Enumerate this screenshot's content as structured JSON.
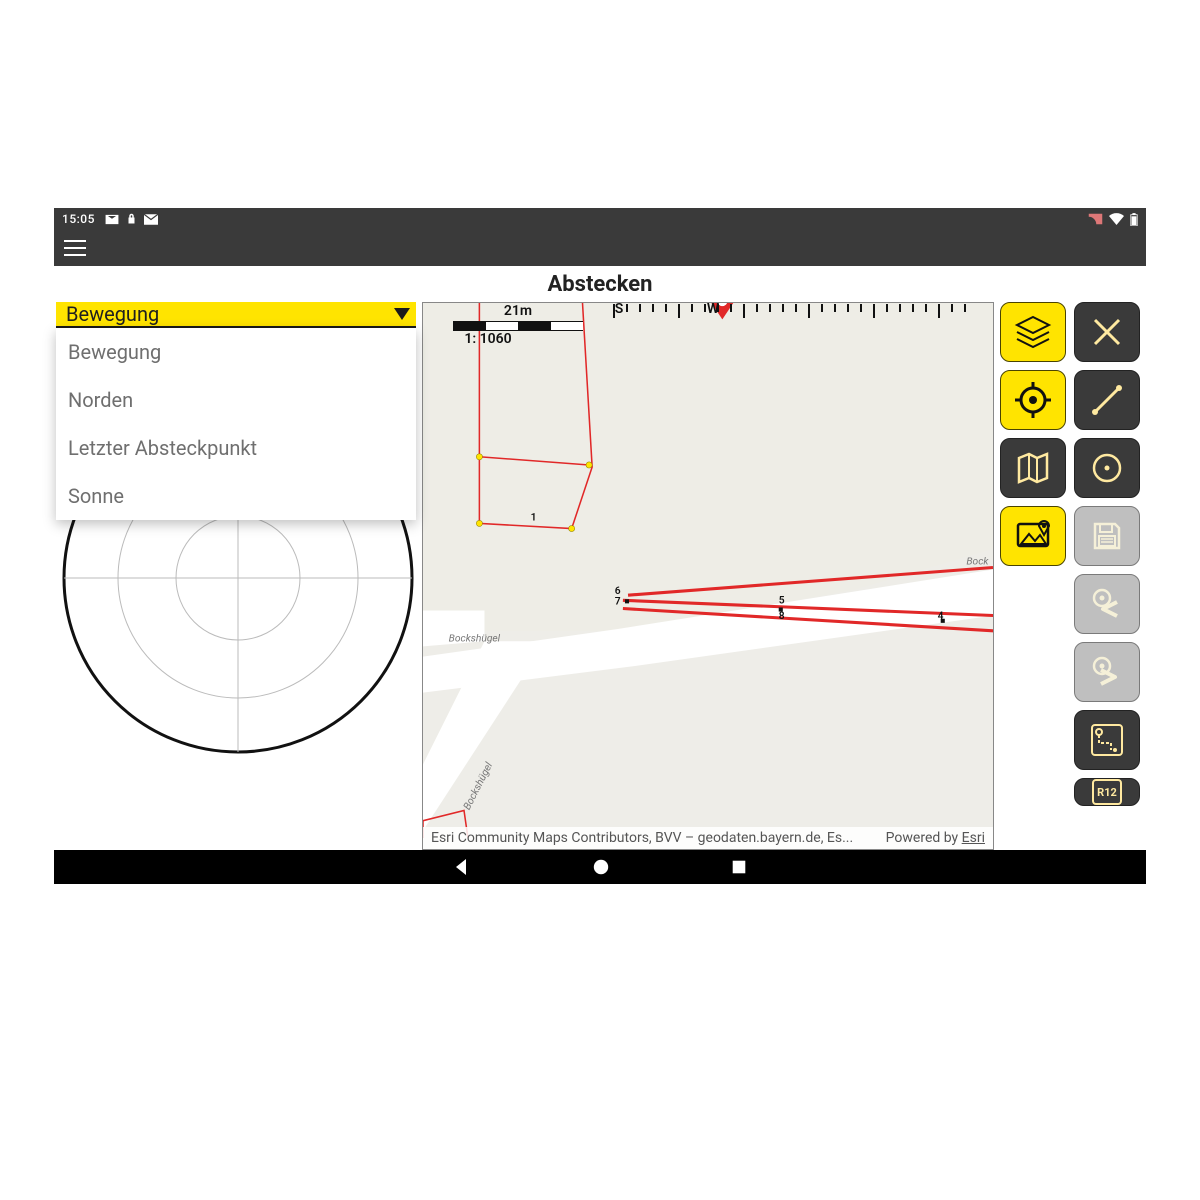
{
  "status": {
    "time": "15:05"
  },
  "title": "Abstecken",
  "dropdown": {
    "selected": "Bewegung",
    "options": [
      "Bewegung",
      "Norden",
      "Letzter Absteckpunkt",
      "Sonne"
    ]
  },
  "map": {
    "scale_distance": "21m",
    "scale_ratio": "1: 1060",
    "heading_letters": [
      "S",
      "W"
    ],
    "street_labels": [
      "Bockshügel",
      "Bockshügel",
      "Bock"
    ],
    "point_labels": [
      "1",
      "6",
      "7",
      "5",
      "8",
      "4"
    ],
    "attribution_left": "Esri Community Maps Contributors, BVV – geodaten.bayern.de, Es...",
    "attribution_powered": "Powered by",
    "attribution_link": "Esri"
  },
  "toolbar": {
    "left": [
      "layers",
      "locate",
      "basemap",
      "geotag"
    ],
    "right": [
      "close",
      "line",
      "circle",
      "save",
      "stake-prev",
      "stake-next",
      "routing",
      "overflow"
    ]
  },
  "colors": {
    "accent": "#ffe400",
    "danger": "#e12828",
    "dark": "#3a3a3a"
  }
}
